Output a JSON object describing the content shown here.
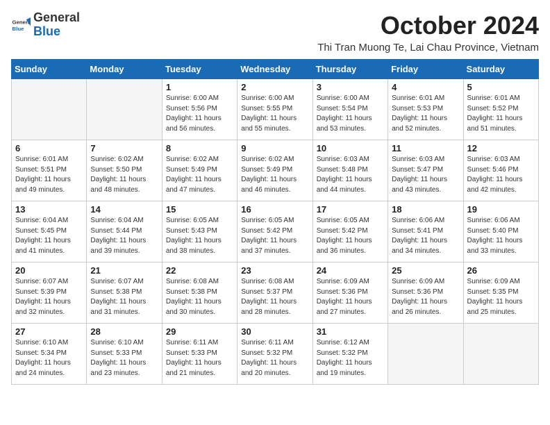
{
  "logo": {
    "general": "General",
    "blue": "Blue"
  },
  "title": "October 2024",
  "subtitle": "Thi Tran Muong Te, Lai Chau Province, Vietnam",
  "days_of_week": [
    "Sunday",
    "Monday",
    "Tuesday",
    "Wednesday",
    "Thursday",
    "Friday",
    "Saturday"
  ],
  "weeks": [
    [
      {
        "day": "",
        "info": ""
      },
      {
        "day": "",
        "info": ""
      },
      {
        "day": "1",
        "info": "Sunrise: 6:00 AM\nSunset: 5:56 PM\nDaylight: 11 hours and 56 minutes."
      },
      {
        "day": "2",
        "info": "Sunrise: 6:00 AM\nSunset: 5:55 PM\nDaylight: 11 hours and 55 minutes."
      },
      {
        "day": "3",
        "info": "Sunrise: 6:00 AM\nSunset: 5:54 PM\nDaylight: 11 hours and 53 minutes."
      },
      {
        "day": "4",
        "info": "Sunrise: 6:01 AM\nSunset: 5:53 PM\nDaylight: 11 hours and 52 minutes."
      },
      {
        "day": "5",
        "info": "Sunrise: 6:01 AM\nSunset: 5:52 PM\nDaylight: 11 hours and 51 minutes."
      }
    ],
    [
      {
        "day": "6",
        "info": "Sunrise: 6:01 AM\nSunset: 5:51 PM\nDaylight: 11 hours and 49 minutes."
      },
      {
        "day": "7",
        "info": "Sunrise: 6:02 AM\nSunset: 5:50 PM\nDaylight: 11 hours and 48 minutes."
      },
      {
        "day": "8",
        "info": "Sunrise: 6:02 AM\nSunset: 5:49 PM\nDaylight: 11 hours and 47 minutes."
      },
      {
        "day": "9",
        "info": "Sunrise: 6:02 AM\nSunset: 5:49 PM\nDaylight: 11 hours and 46 minutes."
      },
      {
        "day": "10",
        "info": "Sunrise: 6:03 AM\nSunset: 5:48 PM\nDaylight: 11 hours and 44 minutes."
      },
      {
        "day": "11",
        "info": "Sunrise: 6:03 AM\nSunset: 5:47 PM\nDaylight: 11 hours and 43 minutes."
      },
      {
        "day": "12",
        "info": "Sunrise: 6:03 AM\nSunset: 5:46 PM\nDaylight: 11 hours and 42 minutes."
      }
    ],
    [
      {
        "day": "13",
        "info": "Sunrise: 6:04 AM\nSunset: 5:45 PM\nDaylight: 11 hours and 41 minutes."
      },
      {
        "day": "14",
        "info": "Sunrise: 6:04 AM\nSunset: 5:44 PM\nDaylight: 11 hours and 39 minutes."
      },
      {
        "day": "15",
        "info": "Sunrise: 6:05 AM\nSunset: 5:43 PM\nDaylight: 11 hours and 38 minutes."
      },
      {
        "day": "16",
        "info": "Sunrise: 6:05 AM\nSunset: 5:42 PM\nDaylight: 11 hours and 37 minutes."
      },
      {
        "day": "17",
        "info": "Sunrise: 6:05 AM\nSunset: 5:42 PM\nDaylight: 11 hours and 36 minutes."
      },
      {
        "day": "18",
        "info": "Sunrise: 6:06 AM\nSunset: 5:41 PM\nDaylight: 11 hours and 34 minutes."
      },
      {
        "day": "19",
        "info": "Sunrise: 6:06 AM\nSunset: 5:40 PM\nDaylight: 11 hours and 33 minutes."
      }
    ],
    [
      {
        "day": "20",
        "info": "Sunrise: 6:07 AM\nSunset: 5:39 PM\nDaylight: 11 hours and 32 minutes."
      },
      {
        "day": "21",
        "info": "Sunrise: 6:07 AM\nSunset: 5:38 PM\nDaylight: 11 hours and 31 minutes."
      },
      {
        "day": "22",
        "info": "Sunrise: 6:08 AM\nSunset: 5:38 PM\nDaylight: 11 hours and 30 minutes."
      },
      {
        "day": "23",
        "info": "Sunrise: 6:08 AM\nSunset: 5:37 PM\nDaylight: 11 hours and 28 minutes."
      },
      {
        "day": "24",
        "info": "Sunrise: 6:09 AM\nSunset: 5:36 PM\nDaylight: 11 hours and 27 minutes."
      },
      {
        "day": "25",
        "info": "Sunrise: 6:09 AM\nSunset: 5:36 PM\nDaylight: 11 hours and 26 minutes."
      },
      {
        "day": "26",
        "info": "Sunrise: 6:09 AM\nSunset: 5:35 PM\nDaylight: 11 hours and 25 minutes."
      }
    ],
    [
      {
        "day": "27",
        "info": "Sunrise: 6:10 AM\nSunset: 5:34 PM\nDaylight: 11 hours and 24 minutes."
      },
      {
        "day": "28",
        "info": "Sunrise: 6:10 AM\nSunset: 5:33 PM\nDaylight: 11 hours and 23 minutes."
      },
      {
        "day": "29",
        "info": "Sunrise: 6:11 AM\nSunset: 5:33 PM\nDaylight: 11 hours and 21 minutes."
      },
      {
        "day": "30",
        "info": "Sunrise: 6:11 AM\nSunset: 5:32 PM\nDaylight: 11 hours and 20 minutes."
      },
      {
        "day": "31",
        "info": "Sunrise: 6:12 AM\nSunset: 5:32 PM\nDaylight: 11 hours and 19 minutes."
      },
      {
        "day": "",
        "info": ""
      },
      {
        "day": "",
        "info": ""
      }
    ]
  ]
}
